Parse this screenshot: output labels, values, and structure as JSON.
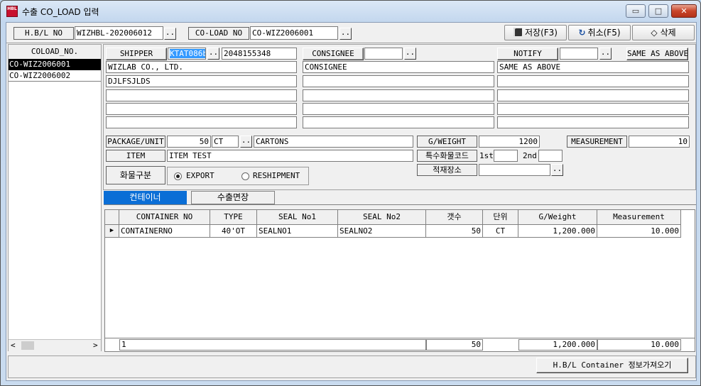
{
  "window": {
    "title": "수출 CO_LOAD 입력",
    "app_icon_text": "HBL",
    "min": "▭",
    "max": "□",
    "close": "✕"
  },
  "topbar": {
    "hbl_label": "H.B/L NO",
    "hbl_value": "WIZHBL-202006012",
    "coload_label": "CO-LOAD NO",
    "coload_value": "CO-WIZ2006001",
    "save_label": "저장(F3)",
    "cancel_label": "취소(F5)",
    "delete_label": "삭제",
    "dots": ".."
  },
  "coload_list": {
    "header": "COLOAD_NO.",
    "items": [
      "CO-WIZ2006001",
      "CO-WIZ2006002"
    ],
    "scroll_left": "<",
    "scroll_right": ">"
  },
  "shipper": {
    "label": "SHIPPER",
    "code": "KTAT086b",
    "number": "2048155348",
    "lines": [
      "WIZLAB CO., LTD.",
      "DJLFSJLDS",
      "",
      "",
      ""
    ]
  },
  "consignee": {
    "label": "CONSIGNEE",
    "code": "",
    "lines": [
      "CONSIGNEE",
      "",
      "",
      "",
      ""
    ]
  },
  "notify": {
    "label": "NOTIFY",
    "code": "",
    "same_button": "SAME AS ABOVE",
    "lines": [
      "SAME AS ABOVE",
      "",
      "",
      "",
      ""
    ]
  },
  "cargo": {
    "package_label": "PACKAGE/UNIT",
    "package_qty": "50",
    "package_unit": "CT",
    "package_desc": "CARTONS",
    "item_label": "ITEM",
    "item_value": "ITEM TEST",
    "gweight_label": "G/WEIGHT",
    "gweight_value": "1200",
    "measurement_label": "MEASUREMENT",
    "measurement_value": "10",
    "special_label": "특수화물코드",
    "first_label": "1st",
    "first_value": "",
    "second_label": "2nd",
    "second_value": "",
    "loading_label": "적재장소",
    "loading_value": "",
    "type_label": "화물구분",
    "export_label": "EXPORT",
    "reshipment_label": "RESHIPMENT"
  },
  "tabs": [
    {
      "label": "컨테이너"
    },
    {
      "label": "수출면장"
    }
  ],
  "grid": {
    "headers": [
      "CONTAINER NO",
      "TYPE",
      "SEAL No1",
      "SEAL No2",
      "갯수",
      "단위",
      "G/Weight",
      "Measurement"
    ],
    "row_marker": "▶",
    "rows": [
      [
        "CONTAINERNO",
        "40'OT",
        "SEALNO1",
        "SEALNO2",
        "50",
        "CT",
        "1,200.000",
        "10.000"
      ]
    ],
    "footer": {
      "count": "1",
      "qty": "50",
      "weight": "1,200.000",
      "measurement": "10.000"
    }
  },
  "bottom": {
    "fetch_button": "H.B/L Container 정보가져오기"
  }
}
